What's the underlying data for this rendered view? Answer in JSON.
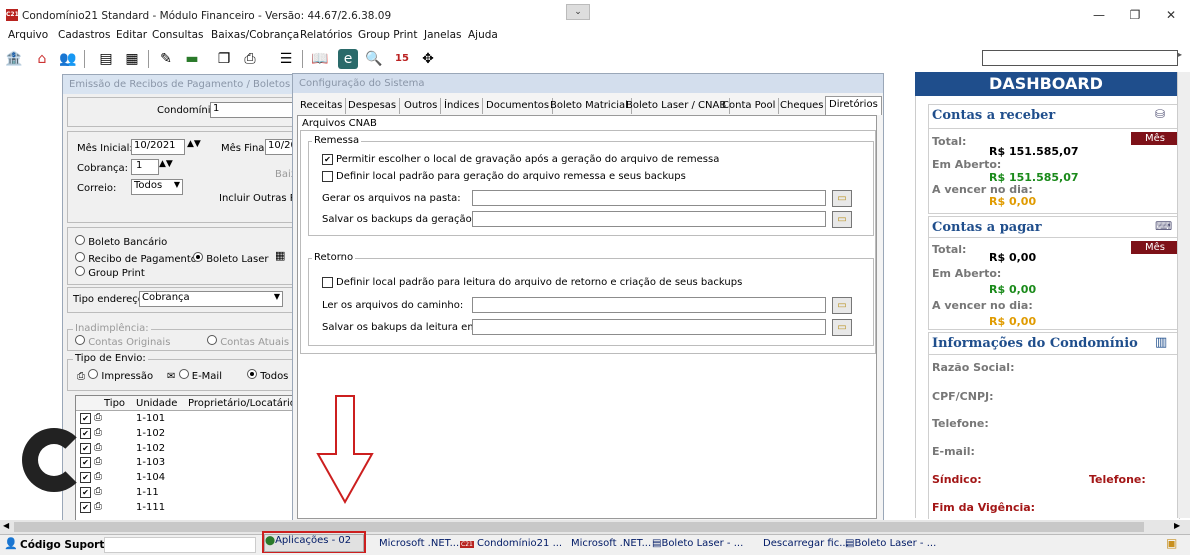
{
  "window": {
    "title": "Condomínio21 Standard - Módulo Financeiro - Versão: 44.67/2.6.38.09",
    "app_icon": "C21",
    "controls": [
      "—",
      "❐",
      "✕"
    ]
  },
  "menu": [
    "Arquivo",
    "Cadastros",
    "Editar",
    "Consultas",
    "Baixas/Cobrança",
    "Relatórios",
    "Group Print",
    "Janelas",
    "Ajuda"
  ],
  "toolbar_icons": [
    "bank-icon",
    "home-icon",
    "users-icon",
    "document-icon",
    "calculator-icon",
    "edit-icon",
    "money-icon",
    "copy-icon",
    "print-icon",
    "notes-icon",
    "book-icon",
    "calendar-e-icon",
    "search-icon",
    "calendar-15-icon",
    "network-icon"
  ],
  "recibos": {
    "title": "Emissão de Recibos de Pagamento / Boletos Ban",
    "condominio_label": "Condomínio:",
    "condominio_value": "1",
    "mes_inicial_label": "Mês Inicial:",
    "mes_inicial_value": "10/2021",
    "mes_final_label": "Mês Final:",
    "mes_final_value": "10/20",
    "cobranca_label": "Cobrança:",
    "cobranca_value": "1",
    "correio_label": "Correio:",
    "correio_value": "Todos",
    "baix_text": "Baix",
    "incluir_text": "Incluir Outras Rec",
    "opt_boleto_bancario": "Boleto Bancário",
    "opt_recibo": "Recibo de Pagamento",
    "opt_boleto_laser": "Boleto Laser",
    "opt_group_print": "Group Print",
    "tipo_endereco_label": "Tipo endereço:",
    "tipo_endereco_value": "Cobrança",
    "inadimplencia_label": "Inadimplência:",
    "contas_originais": "Contas Originais",
    "contas_atuais": "Contas Atuais",
    "tipo_envio_label": "Tipo de Envio:",
    "impressao": "Impressão",
    "email": "E-Mail",
    "todos": "Todos",
    "grid_headers": [
      "Tipo",
      "Unidade",
      "Proprietário/Locatário"
    ],
    "units": [
      "1-101",
      "1-102",
      "1-102",
      "1-103",
      "1-104",
      "1-11",
      "1-111"
    ]
  },
  "config": {
    "title": "Configuração do Sistema",
    "tabs": [
      "Receitas",
      "Despesas",
      "Outros",
      "Índices",
      "Documentos",
      "Boleto Matricial",
      "Boleto Laser / CNAB",
      "Conta Pool",
      "Cheques",
      "Diretórios"
    ],
    "active_tab": "Diretórios",
    "cnab_label": "Arquivos CNAB",
    "remessa_label": "Remessa",
    "remessa_opt1": "Permitir escolher o local de gravação após a geração do arquivo de remessa",
    "remessa_opt2": "Definir local padrão para geração do arquivo remessa e seus backups",
    "gerar_label": "Gerar os arquivos na pasta:",
    "salvar_backups_label": "Salvar os backups da geração em:",
    "retorno_label": "Retorno",
    "retorno_opt1": "Definir local padrão para leitura do arquivo de retorno e criação de seus backups",
    "ler_label": "Ler os arquivos do caminho:",
    "salvar_bakups_label": "Salvar os bakups da leitura em:"
  },
  "dashboard": {
    "title": "DASHBOARD",
    "receber": {
      "title": "Contas a receber",
      "badge": "Mês",
      "total_label": "Total:",
      "total_value": "R$ 151.585,07",
      "aberto_label": "Em Aberto:",
      "aberto_value": "R$ 151.585,07",
      "vencer_label": "A vencer no dia:",
      "vencer_value": "R$ 0,00"
    },
    "pagar": {
      "title": "Contas a pagar",
      "badge": "Mês",
      "total_label": "Total:",
      "total_value": "R$ 0,00",
      "aberto_label": "Em Aberto:",
      "aberto_value": "R$ 0,00",
      "vencer_label": "A vencer no dia:",
      "vencer_value": "R$ 0,00"
    },
    "info": {
      "title": "Informações do Condomínio",
      "razao": "Razão Social:",
      "cpf": "CPF/CNPJ:",
      "telefone": "Telefone:",
      "email": "E-mail:",
      "sindico": "Síndico:",
      "telefone2": "Telefone:",
      "fim_vigencia": "Fim da Vigência:"
    }
  },
  "statusbar": {
    "codigo_suporte": "Código Suporte:"
  },
  "taskbar": [
    "Aplicações - 02",
    "Microsoft .NET...",
    "Condomínio21 ...",
    "Microsoft .NET...",
    "Boleto Laser - ...",
    "Descarregar fic...",
    "Boleto Laser - ..."
  ],
  "colors": {
    "dashboard_header": "#1f4e8c",
    "badge": "#7d1118",
    "green_value": "#1a8a1a",
    "orange_value": "#e09b00",
    "arrow": "#cc1f1f",
    "highlight_box": "#cc1f1f"
  }
}
